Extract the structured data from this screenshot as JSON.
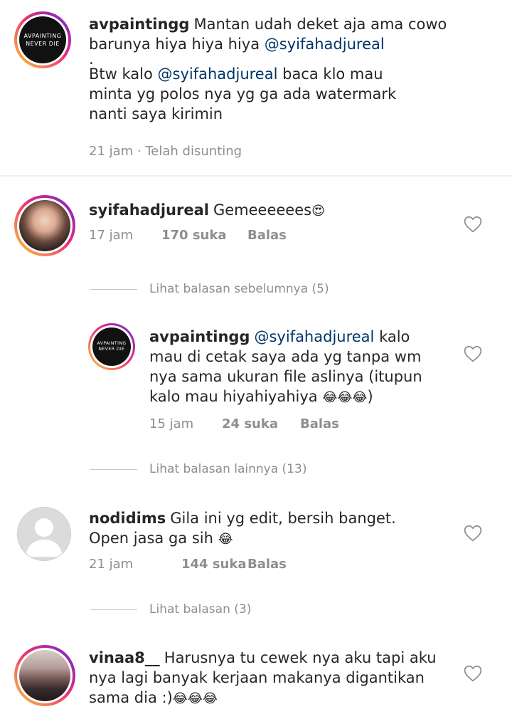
{
  "comments": [
    {
      "username": "avpaintingg",
      "avatar_lines": [
        "AVPAINTING",
        "NEVER DIE"
      ],
      "text_line1": "Mantan udah deket aja ama cowo",
      "text_line2_pre": "barunya hiya hiya hiya ",
      "mention1": "@syifahadjureal",
      "dot": ".",
      "text_line4_pre": "Btw kalo ",
      "mention2": "@syifahadjureal",
      "text_line4_post": " baca klo mau",
      "text_line5": "minta yg polos nya yg ga ada watermark",
      "text_line6": "nanti saya kirimin",
      "meta": "21 jam · Telah disunting"
    },
    {
      "username": "syifahadjureal",
      "text": "Gemeeeeees",
      "emoji": "😍",
      "time": "17 jam",
      "likes": "170 suka",
      "reply": "Balas"
    },
    {
      "username": "avpaintingg",
      "avatar_lines": [
        "AVPAINTING",
        "NEVER DIE"
      ],
      "mention": "@syifahadjureal",
      "line1_post": " kalo",
      "line2": "mau di cetak saya ada yg tanpa wm",
      "line3": "nya sama ukuran file aslinya (itupun",
      "line4": "kalo mau hiyahiyahiya ",
      "line4_emoji": "😂😂😂",
      "line4_end": ")",
      "time": "15 jam",
      "likes": "24 suka",
      "reply": "Balas"
    },
    {
      "username": "nodidims",
      "line1": "Gila ini yg edit, bersih banget.",
      "line2": "Open jasa ga sih ",
      "line2_emoji": "😂",
      "time": "21 jam",
      "likes": "144 suka",
      "reply": "Balas"
    },
    {
      "username": "vinaa8__",
      "line1": "Harusnya tu cewek nya aku tapi aku",
      "line2": "nya lagi banyak kerjaan makanya digantikan",
      "line3": "sama dia :)",
      "line3_emoji": "😂😂😂"
    }
  ],
  "replies_links": {
    "previous": "Lihat balasan sebelumnya (5)",
    "others": "Lihat balasan lainnya (13)",
    "nodidims": "Lihat balasan (3)"
  },
  "icons": {
    "like": "heart-outline-icon"
  },
  "colors": {
    "mention": "#003569",
    "muted": "#8e8e8e",
    "text": "#262626"
  }
}
